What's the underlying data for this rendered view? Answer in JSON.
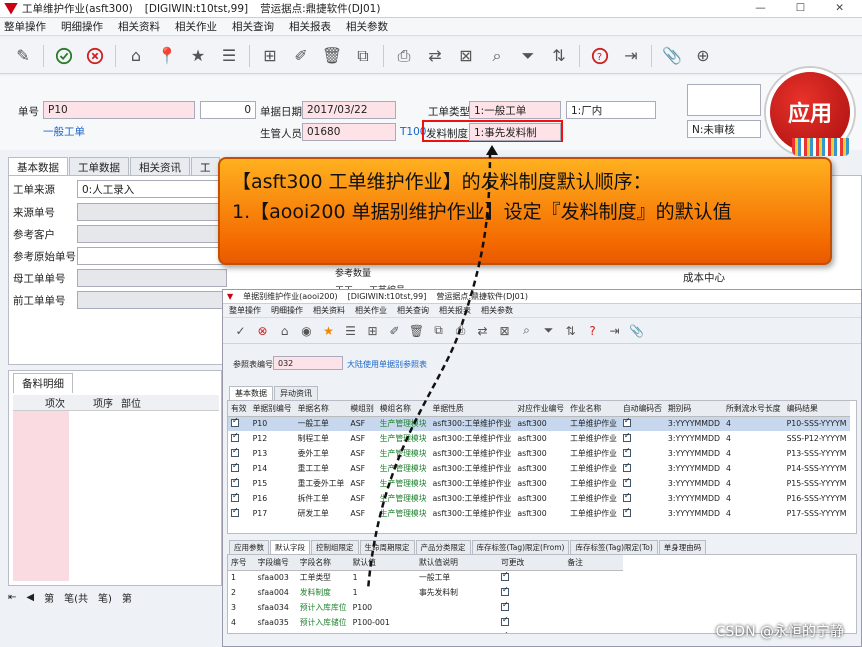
{
  "window": {
    "title": "工单维护作业(asft300)",
    "env": "[DIGIWIN:t10tst,99]",
    "site": "营运据点:鼎捷软件(DJ01)"
  },
  "menu": [
    "整单操作",
    "明细操作",
    "相关资料",
    "相关作业",
    "相关查询",
    "相关报表",
    "相关参数"
  ],
  "header": {
    "doc_no_label": "单号",
    "doc_no": "P10",
    "seq": "0",
    "doc_date_label": "单据日期",
    "doc_date": "2017/03/22",
    "order_type_label": "工单类型",
    "order_type": "1:一般工单",
    "plant": "1:厂内",
    "type_name": "一般工单",
    "owner_label": "生管人员",
    "owner": "01680",
    "owner_code": "T100",
    "issue_rule_label": "发料制度",
    "issue_rule": "1:事先发料制",
    "status": "N:未审核"
  },
  "tabs": [
    "基本数据",
    "工单数据",
    "相关资讯",
    "工"
  ],
  "fields": [
    "工单来源",
    "来源单号",
    "参考客户",
    "参考原始单号",
    "母工单单号",
    "前工单单号"
  ],
  "field_values": {
    "source": "0:人工录入",
    "ref_qty": "参考数量",
    "cost_center": "成本中心",
    "cb1": "工工",
    "cb2": "工艺编号"
  },
  "detail": {
    "tab": "备料明细",
    "cols": [
      "项次",
      "项序",
      "部位"
    ]
  },
  "nav": {
    "page_label": "第",
    "total_label": "笔(共",
    "rec_label": "笔)",
    "page_label2": "第"
  },
  "callout": {
    "line1": "【asft300 工单维护作业】的发料制度默认顺序：",
    "line2": "1.【aooi200 单据别维护作业】设定『发料制度』的默认值"
  },
  "apply_label": "应用",
  "inner": {
    "title": "单据别维护作业(aooi200)",
    "env": "[DIGIWIN:t10tst,99]",
    "site": "营运据点:鼎捷软件(DJ01)",
    "menu": [
      "整单操作",
      "明细操作",
      "相关资料",
      "相关作业",
      "相关查询",
      "相关报表",
      "相关参数"
    ],
    "param_label": "参照表编号",
    "param_val": "032",
    "param_desc": "大陆使用单据别参照表",
    "tabs": [
      "基本数据",
      "异动资讯"
    ],
    "cols": [
      "有效",
      "单据别编号",
      "单据名称",
      "模组别",
      "模组名称",
      "单据性质",
      "对应作业编号",
      "作业名称",
      "自动编码否",
      "期别码",
      "所剩流水号长度",
      "编码结果"
    ],
    "rows": [
      [
        "P10",
        "一般工单",
        "ASF",
        "生产管理模块",
        "asft300:工单维护作业",
        "asft300",
        "工单维护作业",
        "3:YYYYMMDD",
        "4",
        "P10-SSS-YYYYM"
      ],
      [
        "P12",
        "制程工单",
        "ASF",
        "生产管理模块",
        "asft300:工单维护作业",
        "asft300",
        "工单维护作业",
        "3:YYYYMMDD",
        "4",
        "SSS-P12-YYYYM"
      ],
      [
        "P13",
        "委外工单",
        "ASF",
        "生产管理模块",
        "asft300:工单维护作业",
        "asft300",
        "工单维护作业",
        "3:YYYYMMDD",
        "4",
        "P13-SSS-YYYYM"
      ],
      [
        "P14",
        "重工工单",
        "ASF",
        "生产管理模块",
        "asft300:工单维护作业",
        "asft300",
        "工单维护作业",
        "3:YYYYMMDD",
        "4",
        "P14-SSS-YYYYM"
      ],
      [
        "P15",
        "重工委外工单",
        "ASF",
        "生产管理模块",
        "asft300:工单维护作业",
        "asft300",
        "工单维护作业",
        "3:YYYYMMDD",
        "4",
        "P15-SSS-YYYYM"
      ],
      [
        "P16",
        "拆件工单",
        "ASF",
        "生产管理模块",
        "asft300:工单维护作业",
        "asft300",
        "工单维护作业",
        "3:YYYYMMDD",
        "4",
        "P16-SSS-YYYYM"
      ],
      [
        "P17",
        "研发工单",
        "ASF",
        "生产管理模块",
        "asft300:工单维护作业",
        "asft300",
        "工单维护作业",
        "3:YYYYMMDD",
        "4",
        "P17-SSS-YYYYM"
      ]
    ],
    "subtabs": [
      "应用参数",
      "默认字段",
      "控制组限定",
      "生命周期限定",
      "产品分类限定",
      "库存标签(Tag)限定(From)",
      "库存标签(Tag)限定(To)",
      "单身理由码"
    ],
    "dcols": [
      "序号",
      "字段编号",
      "字段名称",
      "默认值",
      "默认值说明",
      "可更改",
      "备注"
    ],
    "drows": [
      [
        "1",
        "sfaa003",
        "工单类型",
        "1",
        "一般工单"
      ],
      [
        "2",
        "sfaa004",
        "发料制度",
        "1",
        "事先发料制"
      ],
      [
        "3",
        "sfaa034",
        "预计入库库位",
        "P100",
        ""
      ],
      [
        "4",
        "sfaa035",
        "预计入库储位",
        "P100-001",
        ""
      ],
      [
        "5",
        "sfaa036",
        "预计入库批号",
        "",
        ""
      ]
    ]
  },
  "watermark": "CSDN @永恒的宁静"
}
